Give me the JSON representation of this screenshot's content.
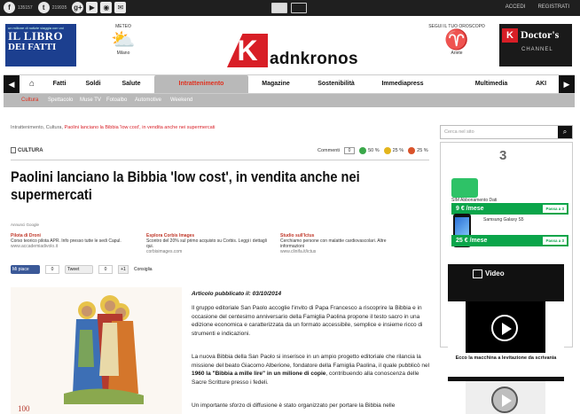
{
  "topbar": {
    "social": [
      {
        "icon": "f",
        "count": "135157"
      },
      {
        "icon": "t",
        "count": "219935"
      },
      {
        "icon": "g+",
        "count": ""
      }
    ],
    "accedi": "ACCEDI",
    "registrati": "REGISTRATI"
  },
  "header": {
    "libro_tag": "un milione di notizie viaggia con voi",
    "libro_line1": "IL LIBRO",
    "libro_line2": "DEI FATTI",
    "meteo_label": "METEO",
    "meteo_city": "Milano",
    "brand": "adnkronos",
    "oroscopo_label": "SEGUI IL TUO OROSCOPO",
    "oroscopo_sign": "Ariete",
    "dl_line1": "Doctor's",
    "dl_line2": "CHANNEL"
  },
  "nav": {
    "items": [
      "Fatti",
      "Soldi",
      "Salute",
      "Intrattenimento",
      "Magazine",
      "Sostenibilità",
      "Immediapress",
      "Multimedia",
      "AKI"
    ]
  },
  "subnav": {
    "items": [
      "Cultura",
      "Spettacolo",
      "Muse TV",
      "Fotoalbo",
      "Automotive",
      "Weekend"
    ]
  },
  "breadcrumb": {
    "path": "Intrattenimento, Cultura, ",
    "current": "Paolini lanciano la Bibbia 'low cost', in vendita anche nei supermercati"
  },
  "article": {
    "category": "CULTURA",
    "comments_label": "Commenti",
    "comments_count": "0",
    "moods": [
      {
        "pct": "50 %",
        "color": "#3aa84a"
      },
      {
        "pct": "25 %",
        "color": "#e3b51c"
      },
      {
        "pct": "25 %",
        "color": "#d9532a"
      }
    ],
    "title": "Paolini lanciano la Bibbia 'low cost', in vendita anche nei supermercati",
    "ads_label": "Annunci Google",
    "ads": [
      {
        "title": "Pilota di Droni",
        "text": "Corso teorico pilota APR. Info presso tutte le sedi Capul.",
        "url": "www.accademiadivolo.it"
      },
      {
        "title": "Esplora Corbis Images",
        "text": "Scontro del 20% sul primo acquisto su Corbis. Leggi i dettagli qui.",
        "url": "corbisimages.com"
      },
      {
        "title": "Studio sull'Ictus",
        "text": "Cerchiamo persone con malattie cardiovascolari. Altre informazioni",
        "url": "www.clinifa.it/ictus"
      }
    ],
    "fb_label": "Mi piace",
    "fb_count": "0",
    "tw_label": "Tweet",
    "tw_count": "0",
    "gp_label": "+1",
    "gp_text": "Consiglia",
    "pubdate": "Articolo pubblicato il: 03/10/2014",
    "p1": "Il gruppo editoriale San Paolo accoglie l'invito di Papa Francesco a riscoprire la Bibbia e in occasione del centesimo anniversario della Famiglia Paolina propone il testo sacro in una edizione economica e caratterizzata da un formato accessibile, semplice e insieme ricco di strumenti e indicazioni.",
    "p2a": "La nuova Bibbia della San Paolo si inserisce in un ampio progetto editoriale che rilancia la missione del beato Giacomo Alberione, fondatore della Famiglia Paolina, il quale pubblicò nel ",
    "p2b": "1960 la \"Bibbia a mille lire\" in un milione di copie",
    "p2c": ", contribuendo alla conoscenza delle Sacre Scritture presso i fedeli.",
    "p3": "Un importante sforzo di diffusione è stato organizzato per portare la Bibbia nelle"
  },
  "sidebar": {
    "search_placeholder": "Cerca nel sito",
    "tre_logo": "3",
    "offers": [
      {
        "name": "SIM Abbonamento Dati",
        "price": "9 € /mese",
        "cta": "Passa a 3"
      },
      {
        "name": "Samsung Galaxy S5",
        "price": "25 € /mese",
        "cta": "Passa a 3"
      }
    ],
    "video_title": "Video",
    "video_caption": "Ecco la macchina a levitazione da scrivania"
  }
}
